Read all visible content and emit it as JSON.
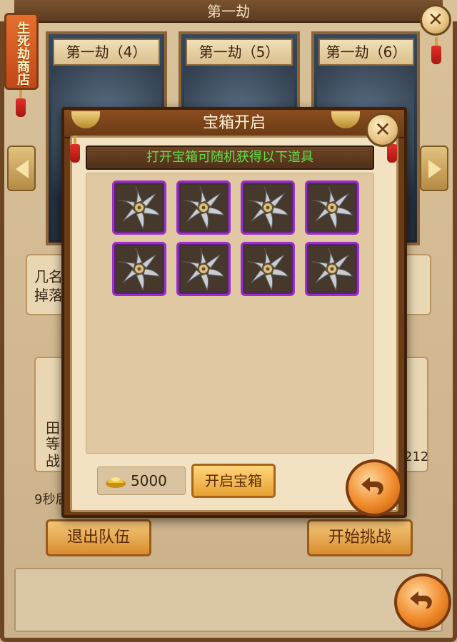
{
  "background": {
    "title": "第一劫",
    "shop_label": "生死劫商店",
    "levels": [
      "第一劫（4）",
      "第一劫（5）",
      "第一劫（6）"
    ],
    "left_snippet": [
      "几名",
      "掉落"
    ],
    "team_snippet": [
      "田",
      "等",
      "战"
    ],
    "right_number": "212",
    "countdown_snippet": "9秒后",
    "exit_team_label": "退出队伍",
    "start_challenge_label": "开始挑战"
  },
  "modal": {
    "title": "宝箱开启",
    "info_text": "打开宝箱可随机获得以下道具",
    "items": [
      {
        "icon": "shuriken-icon"
      },
      {
        "icon": "shuriken-icon"
      },
      {
        "icon": "shuriken-icon"
      },
      {
        "icon": "shuriken-icon"
      },
      {
        "icon": "shuriken-icon"
      },
      {
        "icon": "shuriken-icon"
      },
      {
        "icon": "shuriken-icon"
      },
      {
        "icon": "shuriken-icon"
      }
    ],
    "gold_amount": "5000",
    "open_button_label": "开启宝箱"
  },
  "colors": {
    "info_text": "#62e04a",
    "item_border": "#9b2fc9",
    "accent_orange": "#f08a2a"
  }
}
